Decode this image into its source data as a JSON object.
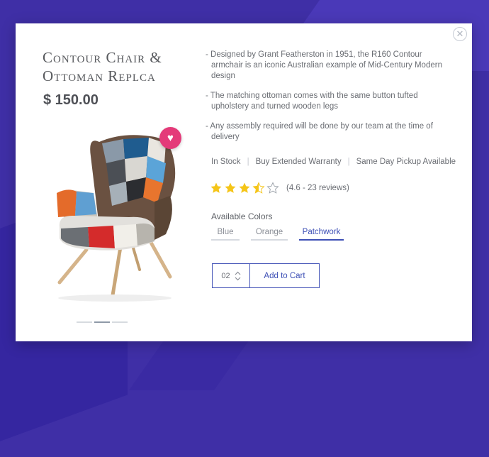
{
  "product": {
    "title": "Contour Chair & Ottoman Replca",
    "price": "$ 150.00",
    "description": [
      "- Designed by Grant Featherston in 1951, the R160 Contour armchair is an iconic Australian example of Mid-Century Modern design",
      "- The matching ottoman comes with the same button tufted upholstery and turned wooden legs",
      "- Any assembly required will be done by our team at the time of delivery"
    ],
    "info": [
      "In Stock",
      "Buy Extended Warranty",
      "Same Day Pickup Available"
    ],
    "rating": {
      "value": 3.5,
      "max": 5,
      "text": "(4.6 - 23 reviews)"
    },
    "colors_label": "Available Colors",
    "colors": [
      "Blue",
      "Orange",
      "Patchwork"
    ],
    "selected_color": "Patchwork",
    "quantity": "02",
    "add_to_cart": "Add to Cart"
  },
  "gallery": {
    "slides": 3,
    "active_index": 1
  },
  "icons": {
    "close": "close-icon",
    "wishlist": "heart-icon",
    "stepper": "chevron-up-down-icon",
    "star": "star-icon"
  },
  "theme": {
    "background": "#3f2fa6",
    "accent": "#3d4fb5",
    "wishlist": "#e43a79",
    "star": "#f5c518"
  }
}
